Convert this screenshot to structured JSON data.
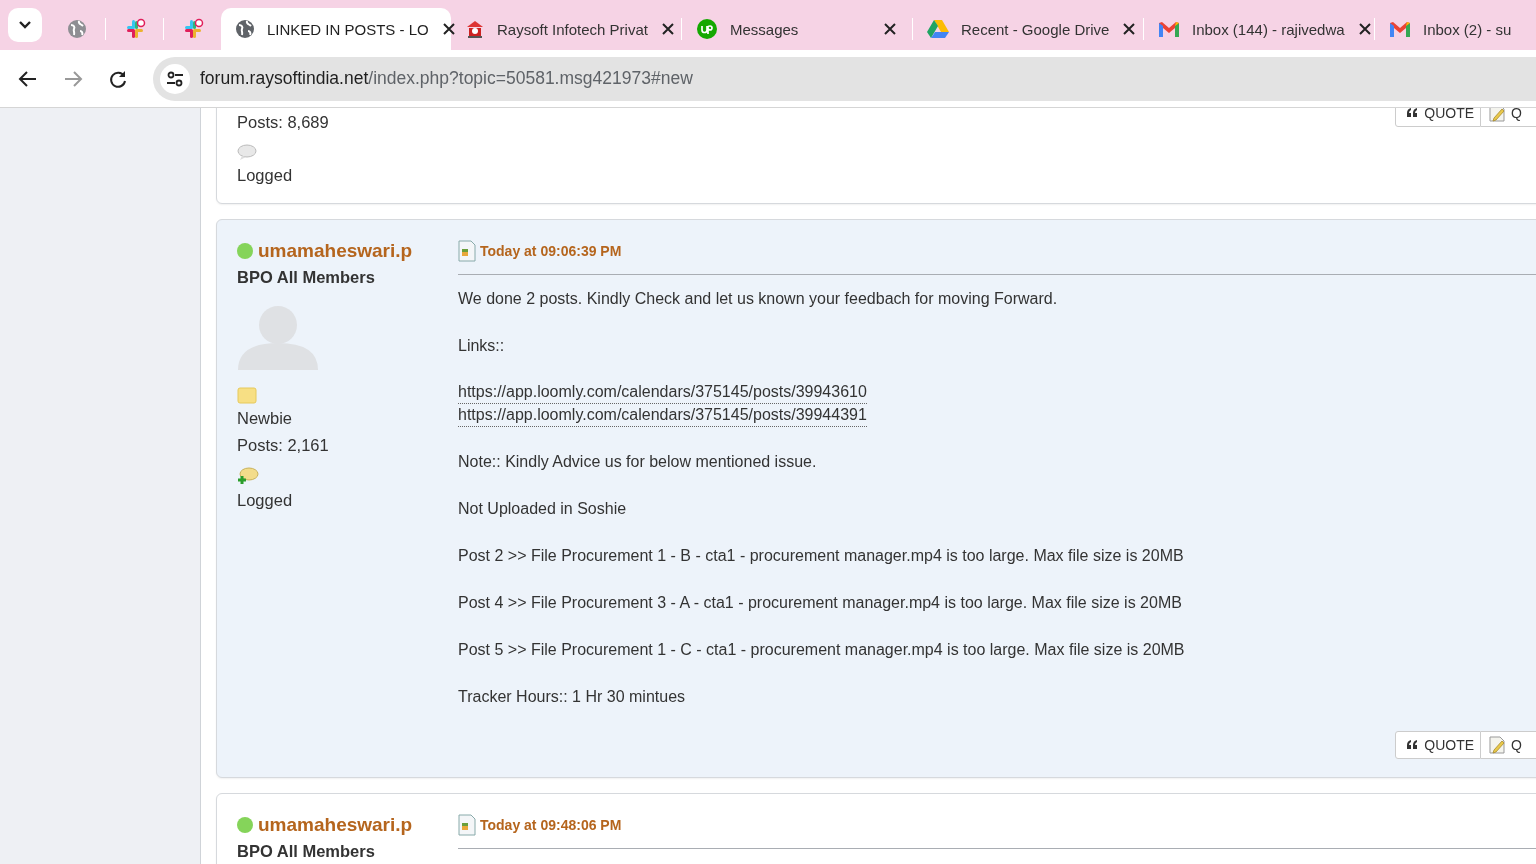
{
  "browser": {
    "tabs": [
      {
        "kind": "globe",
        "pinned": true,
        "selected": false
      },
      {
        "kind": "slack",
        "pinned": true,
        "selected": false
      },
      {
        "kind": "slack",
        "pinned": true,
        "selected": false
      },
      {
        "kind": "globe",
        "pinned": false,
        "selected": true,
        "title": "LINKED IN POSTS - LO",
        "closable": true
      },
      {
        "kind": "raysoft",
        "pinned": false,
        "selected": false,
        "title": "Raysoft Infotech Privat",
        "closable": true
      },
      {
        "kind": "upwork",
        "pinned": false,
        "selected": false,
        "title": "Messages",
        "closable": true
      },
      {
        "kind": "drive",
        "pinned": false,
        "selected": false,
        "title": "Recent - Google Drive",
        "closable": true
      },
      {
        "kind": "gmail",
        "pinned": false,
        "selected": false,
        "title": "Inbox (144) - rajivedwa",
        "closable": true
      },
      {
        "kind": "gmail",
        "pinned": false,
        "selected": false,
        "title": "Inbox (2) - su",
        "closable": false
      }
    ],
    "address": {
      "domain": "forum.raysoftindia.net",
      "path": "/index.php?topic=50581.msg421973#new"
    }
  },
  "posts": [
    {
      "highlighted": false,
      "posts_count": "Posts: 8,689",
      "logged": "Logged",
      "buttons": [
        {
          "kind": "quote",
          "label": "QUOTE"
        },
        {
          "kind": "edit",
          "label": "Q"
        }
      ]
    },
    {
      "highlighted": true,
      "online": true,
      "author": "umamaheswari.p",
      "group": "BPO All Members",
      "rank": "Newbie",
      "posts_count": "Posts: 2,161",
      "logged": "Logged",
      "time": "Today at 09:06:39 PM",
      "body": [
        {
          "kind": "text",
          "text": "We done 2 posts. Kindly Check and let us known your feedbach for moving Forward."
        },
        {
          "kind": "text",
          "text": "Links::"
        },
        {
          "kind": "links",
          "links": [
            "https://app.loomly.com/calendars/375145/posts/39943610",
            "https://app.loomly.com/calendars/375145/posts/39944391"
          ]
        },
        {
          "kind": "text",
          "text": "Note:: Kindly Advice us for below mentioned issue."
        },
        {
          "kind": "text",
          "text": "Not Uploaded in Soshie"
        },
        {
          "kind": "text",
          "text": "Post 2 >> File Procurement 1 - B - cta1 - procurement manager.mp4 is too large. Max file size is 20MB"
        },
        {
          "kind": "text",
          "text": "Post 4 >> File Procurement 3 - A - cta1 - procurement manager.mp4 is too large. Max file size is 20MB"
        },
        {
          "kind": "text",
          "text": "Post 5 >> File Procurement 1 - C - cta1 - procurement manager.mp4 is too large. Max file size is 20MB"
        },
        {
          "kind": "text",
          "text": "Tracker Hours:: 1 Hr 30 mintues"
        }
      ],
      "buttons": [
        {
          "kind": "quote",
          "label": "QUOTE"
        },
        {
          "kind": "edit",
          "label": "Q"
        }
      ]
    },
    {
      "highlighted": false,
      "online": true,
      "author": "umamaheswari.p",
      "group": "BPO All Members",
      "time": "Today at 09:48:06 PM"
    }
  ]
}
